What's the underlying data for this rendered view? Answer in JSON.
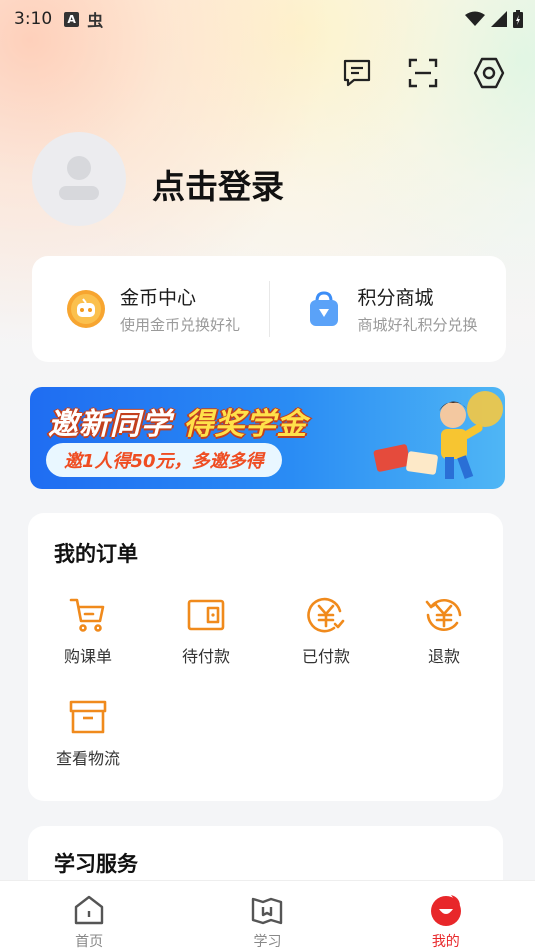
{
  "status_bar": {
    "time": "3:10",
    "a_badge": "A",
    "bug_glyph": "虫"
  },
  "header": {
    "login_prompt": "点击登录"
  },
  "wallet": {
    "coins": {
      "title": "金币中心",
      "subtitle": "使用金币兑换好礼",
      "color": "#f39a1e"
    },
    "points": {
      "title": "积分商城",
      "subtitle": "商城好礼积分兑换",
      "color": "#3d8ef7"
    }
  },
  "banner": {
    "title_part1": "邀新同学",
    "title_part2": "得奖学金",
    "tagline": "邀1人得50元，多邀多得"
  },
  "orders": {
    "title": "我的订单",
    "items": [
      {
        "label": "购课单",
        "icon": "cart-icon"
      },
      {
        "label": "待付款",
        "icon": "wallet-icon"
      },
      {
        "label": "已付款",
        "icon": "yuan-check-icon"
      },
      {
        "label": "退款",
        "icon": "refund-icon"
      },
      {
        "label": "查看物流",
        "icon": "box-icon"
      }
    ]
  },
  "study_service": {
    "title": "学习服务"
  },
  "tabbar": {
    "tabs": [
      {
        "label": "首页",
        "icon": "home-icon",
        "active": false
      },
      {
        "label": "学习",
        "icon": "book-icon",
        "active": false
      },
      {
        "label": "我的",
        "icon": "profile-icon",
        "active": true
      }
    ]
  },
  "colors": {
    "accent": "#e8272a",
    "order_icon": "#f08a1c"
  }
}
